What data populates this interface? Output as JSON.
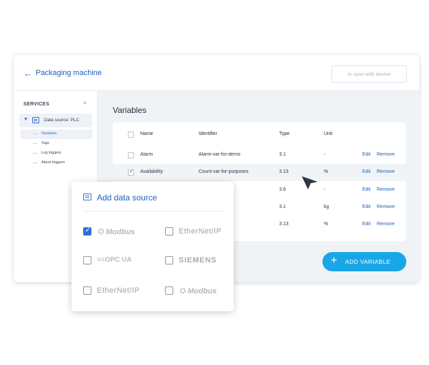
{
  "header": {
    "back_icon": "arrow-left-icon",
    "title": "Packaging machine",
    "sync_label": "In sync with device"
  },
  "sidebar": {
    "services_label": "SERVICES",
    "add_icon": "plus-icon",
    "data_source": {
      "label": "Data source: PLC",
      "icon": "list-box-icon",
      "caret_icon": "triangle-down-icon"
    },
    "items": [
      {
        "label": "Variables",
        "active": true
      },
      {
        "label": "Tags",
        "active": false
      },
      {
        "label": "Log triggers",
        "active": false
      },
      {
        "label": "Alarm triggers",
        "active": false
      }
    ]
  },
  "main": {
    "title": "Variables",
    "table": {
      "columns": [
        "Name",
        "Identifier",
        "Type",
        "Unit"
      ],
      "rows": [
        {
          "name": "Alarm",
          "identifier": "Alarm-var-for-demo",
          "type": "3.1",
          "unit": "-",
          "checked": false,
          "edit": "Edit",
          "remove": "Remove"
        },
        {
          "name": "Availability",
          "identifier": "Count-var-for-purposes",
          "type": "3.13",
          "unit": "%",
          "checked": true,
          "edit": "Edit",
          "remove": "Remove"
        },
        {
          "name": "",
          "identifier": "urposes",
          "type": "3.8",
          "unit": "-",
          "checked": false,
          "edit": "Edit",
          "remove": "Remove"
        },
        {
          "name": "",
          "identifier": "emo",
          "type": "3.1",
          "unit": "kg",
          "checked": false,
          "edit": "Edit",
          "remove": "Remove"
        },
        {
          "name": "",
          "identifier": "urposes",
          "type": "3.13",
          "unit": "%",
          "checked": false,
          "edit": "Edit",
          "remove": "Remove"
        }
      ]
    },
    "add_button": {
      "label": "ADD VARIABLE",
      "icon": "plus-icon"
    }
  },
  "popup": {
    "title": "Add data source",
    "icon": "list-box-icon",
    "options": [
      {
        "logo": "Modbus",
        "checked": true
      },
      {
        "logo": "EtherNet/IP",
        "checked": false
      },
      {
        "logo": "OPC UA",
        "checked": false
      },
      {
        "logo": "SIEMENS",
        "checked": false
      },
      {
        "logo": "EtherNet/IP",
        "checked": false
      },
      {
        "logo": "Modbus",
        "checked": false
      }
    ]
  },
  "colors": {
    "accent": "#1e5fb8",
    "button": "#19a6e6",
    "background": "#f0f3f6"
  }
}
